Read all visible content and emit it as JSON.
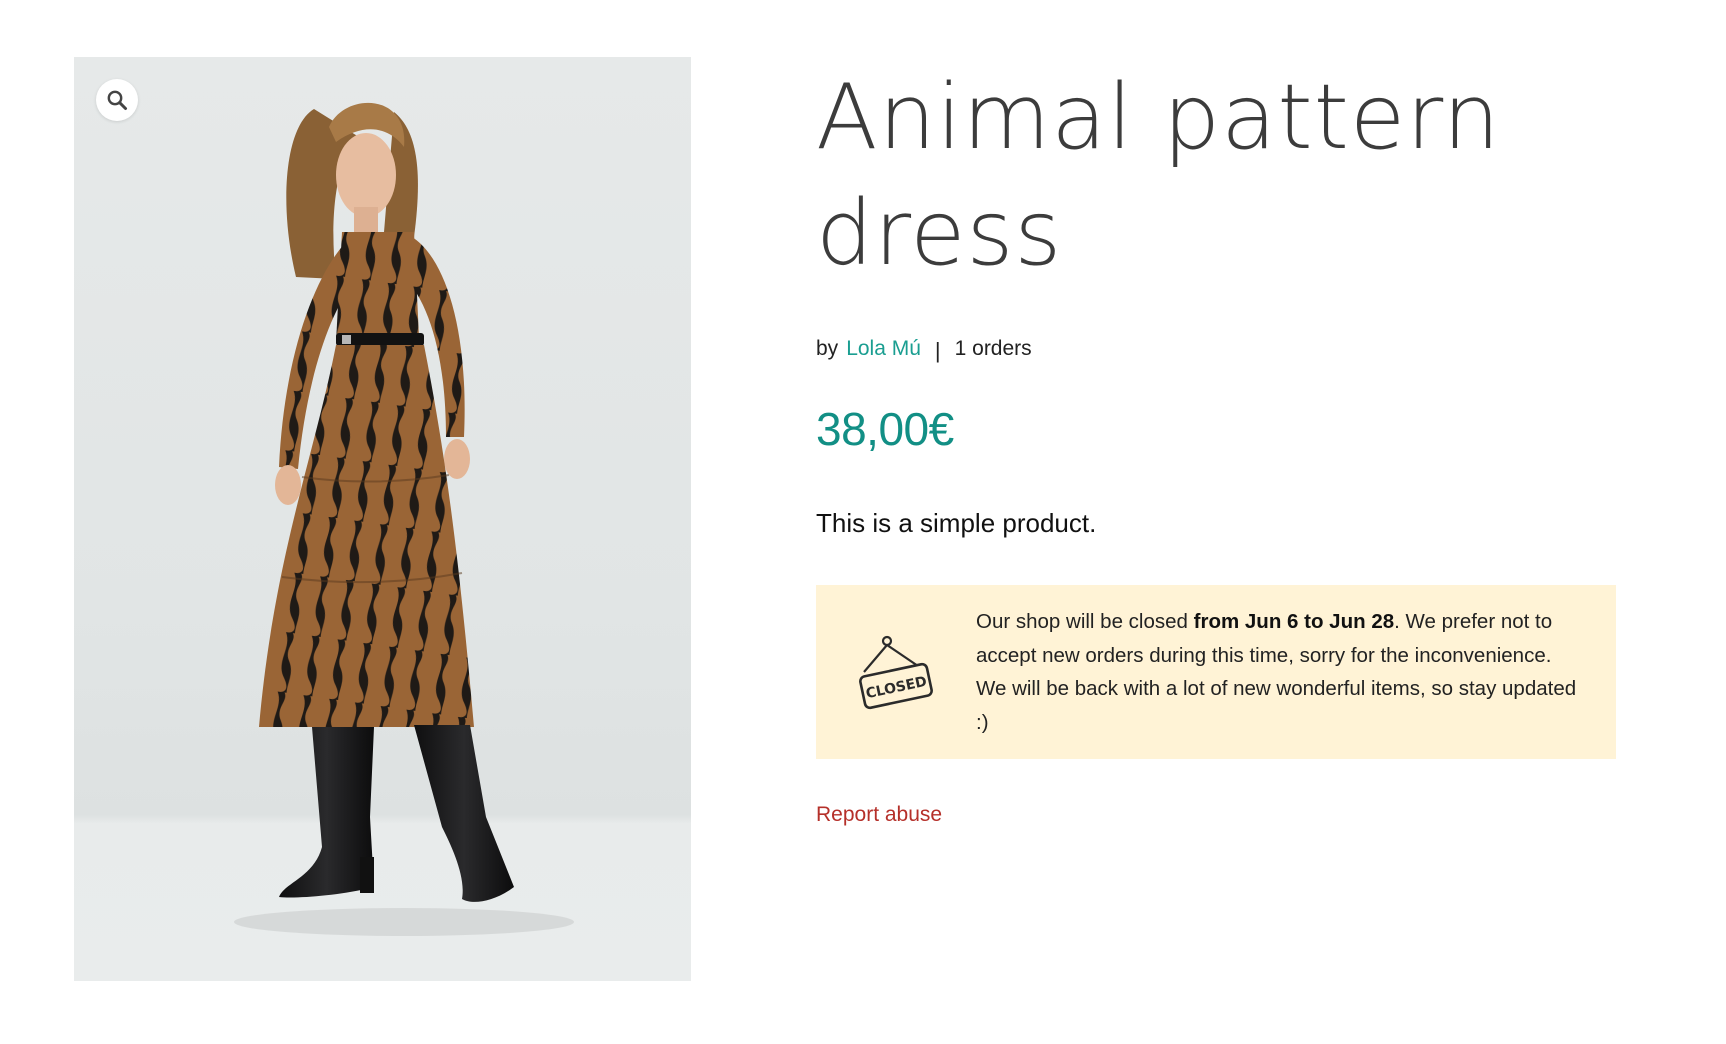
{
  "product": {
    "title": "Animal pattern dress",
    "by_label": "by",
    "vendor": "Lola Mú",
    "separator": "|",
    "orders": "1 orders",
    "price": "38,00€",
    "description": "This is a simple product."
  },
  "notice": {
    "icon": "closed-sign-icon",
    "icon_text": "CLOSED",
    "text_before": "Our shop will be closed ",
    "text_bold": "from Jun 6 to Jun 28",
    "text_after": ". We prefer not to accept new orders during this time, sorry for the inconvenience. We will be back with a lot of new wonderful items, so stay updated :)"
  },
  "actions": {
    "report_abuse": "Report abuse",
    "zoom_icon": "zoom-icon"
  },
  "colors": {
    "accent": "#128f85",
    "vendor_link": "#1a9e91",
    "notice_bg": "#fff3d6",
    "report_link": "#b5302a"
  }
}
